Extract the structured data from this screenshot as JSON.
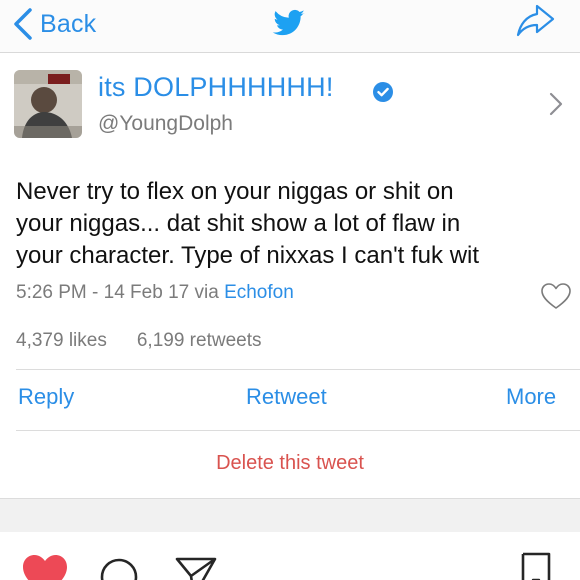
{
  "nav": {
    "back_label": "Back"
  },
  "profile": {
    "display_name": "its DOLPHHHHHH!",
    "handle": "@YoungDolph"
  },
  "tweet": {
    "text_line1": "Never try to flex on your niggas or shit on",
    "text_line2": "your niggas...  dat shit show a lot of flaw in",
    "text_line3": "your character. Type of nixxas I can't fuk wit",
    "timestamp": "5:26 PM - 14 Feb 17 via ",
    "via": "Echofon",
    "likes": "4,379 likes",
    "retweets": "6,199 retweets"
  },
  "actions": {
    "reply": "Reply",
    "retweet": "Retweet",
    "more": "More",
    "delete": "Delete this tweet"
  },
  "colors": {
    "accent": "#2b8ee6",
    "delete": "#d9534f",
    "like": "#ed4956"
  },
  "icons": {
    "back": "chevron-left-icon",
    "twitter": "twitter-bird-icon",
    "share": "share-icon",
    "verified": "verified-badge-icon",
    "profile_chevron": "chevron-right-icon",
    "like": "heart-outline-icon",
    "ig_like": "heart-filled-icon",
    "ig_comment": "comment-icon",
    "ig_share": "send-icon",
    "ig_save": "bookmark-icon"
  }
}
